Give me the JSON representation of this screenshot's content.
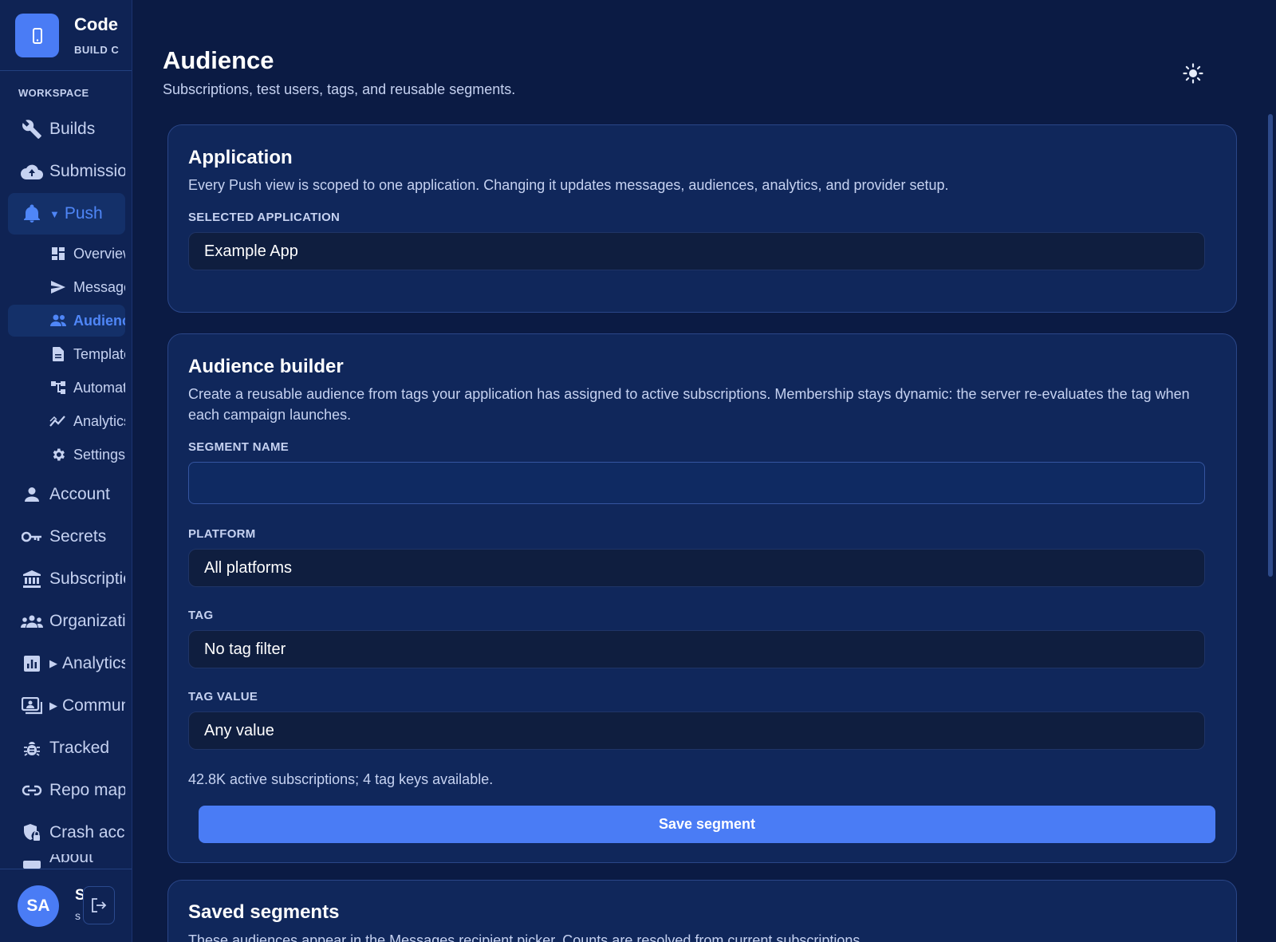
{
  "app": {
    "brand_name": "Codemagic",
    "brand_sub": "BUILD CONSOLE"
  },
  "sidebar": {
    "section_label": "WORKSPACE",
    "items": [
      {
        "label": "Builds",
        "icon": "wrench-icon"
      },
      {
        "label": "Submissions",
        "icon": "cloud-upload-icon"
      },
      {
        "label": "Push",
        "icon": "bell-icon",
        "expanded": true
      },
      {
        "label": "Account",
        "icon": "person-icon"
      },
      {
        "label": "Secrets",
        "icon": "key-icon"
      },
      {
        "label": "Subscriptions",
        "icon": "bank-icon"
      },
      {
        "label": "Organizations",
        "icon": "people-icon"
      },
      {
        "label": "Analytics",
        "icon": "chart-icon",
        "collapsed": true
      },
      {
        "label": "Community",
        "icon": "screen-icon",
        "collapsed": true
      },
      {
        "label": "Tracked",
        "icon": "bug-icon"
      },
      {
        "label": "Repo mapping",
        "icon": "link-icon"
      },
      {
        "label": "Crash access",
        "icon": "shield-lock-icon"
      },
      {
        "label": "About",
        "icon": "info-icon"
      }
    ],
    "push_subitems": [
      {
        "label": "Overview",
        "icon": "dashboard-icon"
      },
      {
        "label": "Messages",
        "icon": "send-icon"
      },
      {
        "label": "Audience",
        "icon": "group-icon",
        "active": true
      },
      {
        "label": "Templates",
        "icon": "document-icon"
      },
      {
        "label": "Automations",
        "icon": "flow-icon"
      },
      {
        "label": "Analytics",
        "icon": "trend-icon"
      },
      {
        "label": "Settings",
        "icon": "gear-icon"
      }
    ],
    "user": {
      "initials": "SA",
      "name": "S",
      "email": "s"
    }
  },
  "header": {
    "title": "Audience",
    "subtitle": "Subscriptions, test users, tags, and reusable segments."
  },
  "application_card": {
    "title": "Application",
    "description": "Every Push view is scoped to one application. Changing it updates messages, audiences, analytics, and provider setup.",
    "field_label": "SELECTED APPLICATION",
    "selected_value": "Example App"
  },
  "builder_card": {
    "title": "Audience builder",
    "description": "Create a reusable audience from tags your application has assigned to active subscriptions. Membership stays dynamic: the server re-evaluates the tag when each campaign launches.",
    "segment_name_label": "SEGMENT NAME",
    "segment_name_value": "",
    "platform_label": "PLATFORM",
    "platform_value": "All platforms",
    "tag_label": "TAG",
    "tag_value": "No tag filter",
    "tag_value_label": "TAG VALUE",
    "tag_value_value": "Any value",
    "stats": "42.8K active subscriptions; 4 tag keys available.",
    "save_label": "Save segment"
  },
  "saved_card": {
    "title": "Saved segments",
    "description": "These audiences appear in the Messages recipient picker. Counts are resolved from current subscriptions."
  },
  "colors": {
    "accent": "#4a7cf5",
    "background": "#0b1b44",
    "card": "#10275b"
  }
}
